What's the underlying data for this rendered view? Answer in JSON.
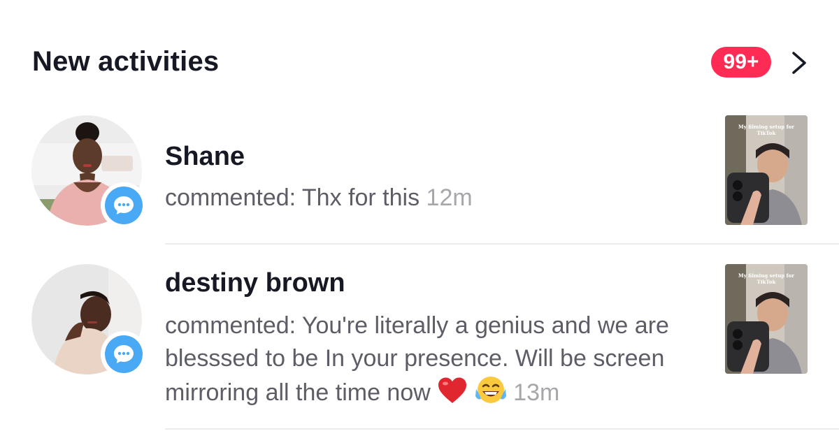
{
  "header": {
    "title": "New activities",
    "badge_count": "99+"
  },
  "colors": {
    "badge": "#fe2c55",
    "comment_icon": "#4aa9f5",
    "text_primary": "#161823",
    "text_secondary": "#5c5d66",
    "text_time": "#a6a7ab"
  },
  "activities": [
    {
      "username": "Shane",
      "comment": "commented: Thx for this",
      "time": "12m",
      "thumbnail_caption": "My filming setup for TikTok"
    },
    {
      "username": "destiny brown",
      "comment": "commented: You're literally a genius and we are blesssed to be In your presence. Will be screen mirroring all the time now",
      "time": "13m",
      "emojis": [
        "red-heart",
        "tears-of-joy"
      ],
      "thumbnail_caption": "My filming setup for TikTok"
    }
  ]
}
